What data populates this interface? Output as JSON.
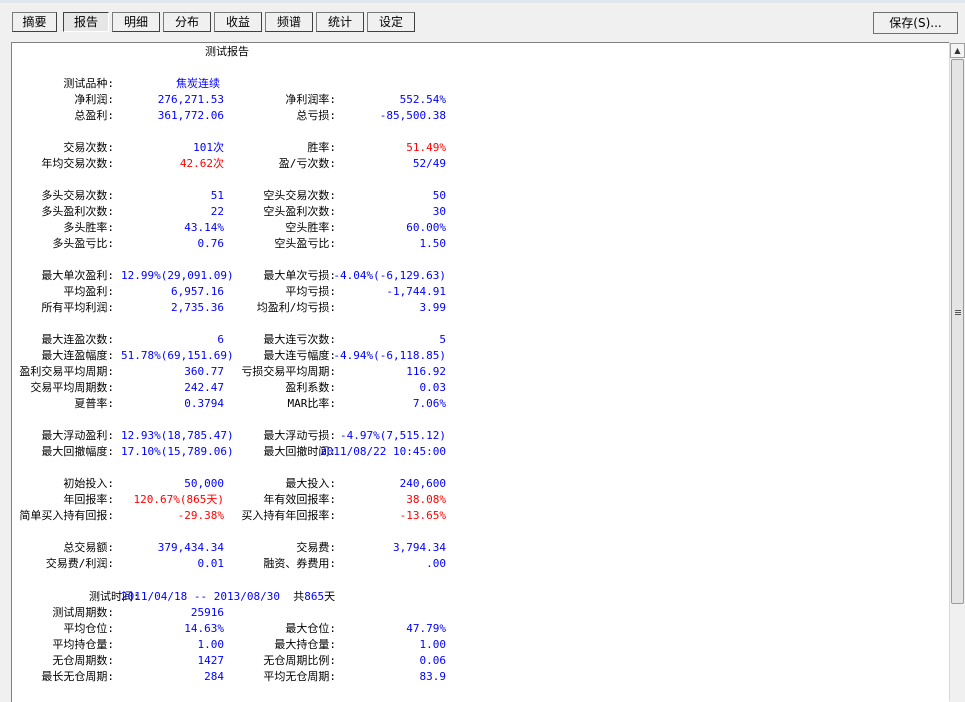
{
  "tabs": [
    "摘要",
    "报告",
    "明细",
    "分布",
    "收益",
    "频谱",
    "统计",
    "设定"
  ],
  "save_label": "保存(S)...",
  "report_title": "测试报告",
  "rows": [
    {
      "l1": "测试品种:",
      "v1": "焦炭连续",
      "c1": "blu",
      "l2": "",
      "v2": "",
      "c2": "blu"
    },
    {
      "l1": "净利润:",
      "v1": "276,271.53",
      "c1": "blu",
      "l2": "净利润率:",
      "v2": "552.54%",
      "c2": "blu"
    },
    {
      "l1": "总盈利:",
      "v1": "361,772.06",
      "c1": "blu",
      "l2": "总亏损:",
      "v2": "-85,500.38",
      "c2": "blu"
    },
    {
      "l1": "交易次数:",
      "v1": "101次",
      "c1": "blu",
      "l2": "胜率:",
      "v2": "51.49%",
      "c2": "red"
    },
    {
      "l1": "年均交易次数:",
      "v1": "42.62次",
      "c1": "red",
      "l2": "盈/亏次数:",
      "v2": "52/49",
      "c2": "blu"
    },
    {
      "l1": "多头交易次数:",
      "v1": "51",
      "c1": "blu",
      "l2": "空头交易次数:",
      "v2": "50",
      "c2": "blu"
    },
    {
      "l1": "多头盈利次数:",
      "v1": "22",
      "c1": "blu",
      "l2": "空头盈利次数:",
      "v2": "30",
      "c2": "blu"
    },
    {
      "l1": "多头胜率:",
      "v1": "43.14%",
      "c1": "blu",
      "l2": "空头胜率:",
      "v2": "60.00%",
      "c2": "blu"
    },
    {
      "l1": "多头盈亏比:",
      "v1": "0.76",
      "c1": "blu",
      "l2": "空头盈亏比:",
      "v2": "1.50",
      "c2": "blu"
    },
    {
      "l1": "最大单次盈利:",
      "v1": "12.99%(29,091.09)",
      "c1": "blu",
      "l2": "最大单次亏损:",
      "v2": "-4.04%(-6,129.63)",
      "c2": "blu"
    },
    {
      "l1": "平均盈利:",
      "v1": "6,957.16",
      "c1": "blu",
      "l2": "平均亏损:",
      "v2": "-1,744.91",
      "c2": "blu"
    },
    {
      "l1": "所有平均利润:",
      "v1": "2,735.36",
      "c1": "blu",
      "l2": "均盈利/均亏损:",
      "v2": "3.99",
      "c2": "blu"
    },
    {
      "l1": "最大连盈次数:",
      "v1": "6",
      "c1": "blu",
      "l2": "最大连亏次数:",
      "v2": "5",
      "c2": "blu"
    },
    {
      "l1": "最大连盈幅度:",
      "v1": "51.78%(69,151.69)",
      "c1": "blu",
      "l2": "最大连亏幅度:",
      "v2": "-4.94%(-6,118.85)",
      "c2": "blu"
    },
    {
      "l1": "盈利交易平均周期:",
      "v1": "360.77",
      "c1": "blu",
      "l2": "亏损交易平均周期:",
      "v2": "116.92",
      "c2": "blu"
    },
    {
      "l1": "交易平均周期数:",
      "v1": "242.47",
      "c1": "blu",
      "l2": "盈利系数:",
      "v2": "0.03",
      "c2": "blu"
    },
    {
      "l1": "夏普率:",
      "v1": "0.3794",
      "c1": "blu",
      "l2": "MAR比率:",
      "v2": "7.06%",
      "c2": "blu"
    },
    {
      "l1": "最大浮动盈利:",
      "v1": "12.93%(18,785.47)",
      "c1": "blu",
      "l2": "最大浮动亏损:",
      "v2": "-4.97%(7,515.12)",
      "c2": "blu"
    },
    {
      "l1": "最大回撤幅度:",
      "v1": "17.10%(15,789.06)",
      "c1": "blu",
      "l2": "最大回撤时间:",
      "v2": "2011/08/22 10:45:00",
      "c2": "blu"
    },
    {
      "l1": "初始投入:",
      "v1": "50,000",
      "c1": "blu",
      "l2": "最大投入:",
      "v2": "240,600",
      "c2": "blu"
    },
    {
      "l1": "年回报率:",
      "v1": "120.67%(865天)",
      "c1": "red",
      "l2": "年有效回报率:",
      "v2": "38.08%",
      "c2": "red"
    },
    {
      "l1": "简单买入持有回报:",
      "v1": "-29.38%",
      "c1": "red",
      "l2": "买入持有年回报率:",
      "v2": "-13.65%",
      "c2": "red"
    },
    {
      "l1": "总交易额:",
      "v1": "379,434.34",
      "c1": "blu",
      "l2": "交易费:",
      "v2": "3,794.34",
      "c2": "blu"
    },
    {
      "l1": "交易费/利润:",
      "v1": "0.01",
      "c1": "blu",
      "l2": "融资、券费用:",
      "v2": ".00",
      "c2": "blu"
    },
    {
      "l1": "测试时间:",
      "v1": "",
      "c1": "blu",
      "l2": "",
      "v2": "",
      "c2": "blu"
    },
    {
      "l1": "测试周期数:",
      "v1": "25916",
      "c1": "blu",
      "l2": "",
      "v2": "",
      "c2": "blu"
    },
    {
      "l1": "平均仓位:",
      "v1": "14.63%",
      "c1": "blu",
      "l2": "最大仓位:",
      "v2": "47.79%",
      "c2": "blu"
    },
    {
      "l1": "平均持仓量:",
      "v1": "1.00",
      "c1": "blu",
      "l2": "最大持仓量:",
      "v2": "1.00",
      "c2": "blu"
    },
    {
      "l1": "无仓周期数:",
      "v1": "1427",
      "c1": "blu",
      "l2": "无仓周期比例:",
      "v2": "0.06",
      "c2": "blu"
    },
    {
      "l1": "最长无仓周期:",
      "v1": "284",
      "c1": "blu",
      "l2": "平均无仓周期:",
      "v2": "83.9",
      "c2": "blu"
    }
  ],
  "test_time": {
    "range": "2011/04/18 -- 2013/08/30",
    "total_prefix": "共",
    "total_days": "865",
    "days_unit": "天"
  },
  "colors": {
    "value_blue": "#0000ff",
    "value_red": "#ff0000"
  }
}
